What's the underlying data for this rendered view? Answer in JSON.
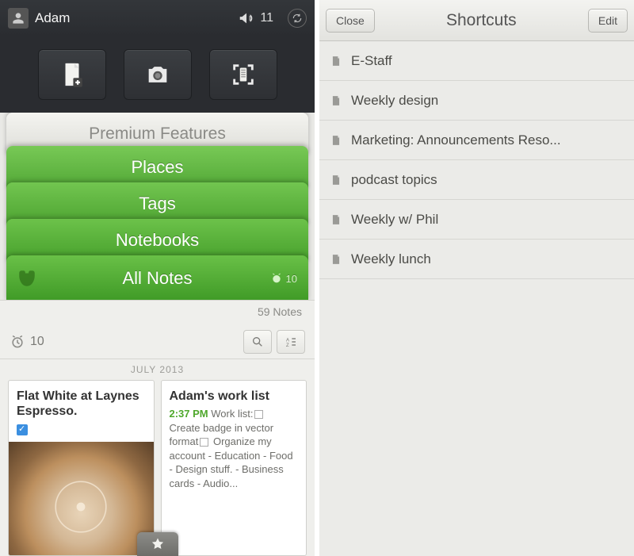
{
  "header": {
    "username": "Adam",
    "announcements_count": "11"
  },
  "actions": {
    "new_note": "new-note",
    "camera": "camera",
    "scan": "page-scan"
  },
  "drawer": {
    "premium_label": "Premium Features",
    "places_label": "Places",
    "tags_label": "Tags",
    "notebooks_label": "Notebooks",
    "allnotes_label": "All Notes",
    "allnotes_reminder_count": "10"
  },
  "notes": {
    "count_label": "59 Notes",
    "reminder_count": "10",
    "section_label": "JULY 2013",
    "cards": [
      {
        "title": "Flat White at Laynes Espresso."
      },
      {
        "title": "Adam's work list",
        "time": "2:37 PM",
        "lead": "Work list:",
        "body_a": "Create badge in vector format",
        "body_b": "Organize my account - Education - Food - Design stuff. - Business cards - Audio..."
      }
    ]
  },
  "shortcuts": {
    "close_label": "Close",
    "title": "Shortcuts",
    "edit_label": "Edit",
    "items": [
      "E-Staff",
      "Weekly design",
      "Marketing: Announcements Reso...",
      "podcast topics",
      "Weekly w/ Phil",
      "Weekly lunch"
    ]
  }
}
